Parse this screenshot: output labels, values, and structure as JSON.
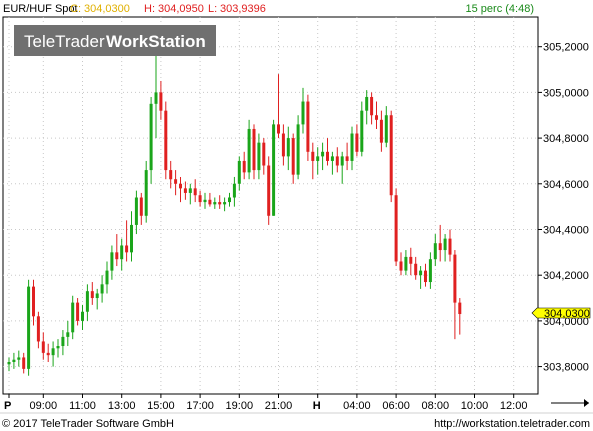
{
  "header": {
    "symbol": "EUR/HUF Spot",
    "close_label": "C:",
    "close_value": "304,0300",
    "high_label": "H:",
    "high_value": "304,0950",
    "low_label": "L:",
    "low_value": "303,9396",
    "interval": "15 perc (4:48)"
  },
  "watermark": {
    "brand": "TeleTrader",
    "product": "WorkStation"
  },
  "price_marker": "304,0300",
  "footer": {
    "copyright": "© 2017 TeleTrader Software GmbH",
    "url": "http://workstation.teletrader.com"
  },
  "colors": {
    "up": "#1aa51a",
    "down": "#e02020",
    "grid": "#c8c8c8",
    "marker_bg": "#ffff00",
    "close_label": "#e0b000",
    "high_low": "#e02020",
    "interval_text": "#1a8a1a",
    "watermark_bg": "#707070"
  },
  "chart_data": {
    "type": "candlestick",
    "title": "EUR/HUF Spot",
    "y_ticks": [
      "303,8000",
      "304,0000",
      "304,2000",
      "304,4000",
      "304,6000",
      "304,8000",
      "305,0000",
      "305,2000"
    ],
    "y_tick_values": [
      303.8,
      304.0,
      304.2,
      304.4,
      304.6,
      304.8,
      305.0,
      305.2
    ],
    "ylim": [
      303.68,
      305.33
    ],
    "x_ticks": [
      "P",
      "09:00",
      "11:00",
      "13:00",
      "15:00",
      "17:00",
      "19:00",
      "21:00",
      "H",
      "04:00",
      "06:00",
      "08:00",
      "10:00",
      "12:00"
    ],
    "x_tick_index": [
      0,
      7,
      15,
      23,
      31,
      39,
      47,
      55,
      63,
      71,
      79,
      87,
      95,
      103
    ],
    "candles": [
      [
        303.81,
        303.84,
        303.78,
        303.82
      ],
      [
        303.82,
        303.86,
        303.79,
        303.83
      ],
      [
        303.83,
        303.87,
        303.8,
        303.84
      ],
      [
        303.84,
        303.86,
        303.77,
        303.79
      ],
      [
        303.79,
        304.18,
        303.76,
        304.15
      ],
      [
        304.15,
        304.18,
        303.98,
        304.02
      ],
      [
        304.02,
        304.04,
        303.88,
        303.91
      ],
      [
        303.91,
        303.95,
        303.83,
        303.86
      ],
      [
        303.86,
        303.9,
        303.82,
        303.85
      ],
      [
        303.85,
        303.91,
        303.8,
        303.88
      ],
      [
        303.88,
        303.92,
        303.84,
        303.89
      ],
      [
        303.89,
        303.96,
        303.85,
        303.93
      ],
      [
        303.93,
        304.0,
        303.89,
        303.95
      ],
      [
        303.95,
        304.11,
        303.92,
        304.08
      ],
      [
        304.08,
        304.1,
        303.98,
        304.0
      ],
      [
        304.0,
        304.07,
        303.96,
        304.04
      ],
      [
        304.04,
        304.16,
        304.0,
        304.13
      ],
      [
        304.13,
        304.17,
        304.07,
        304.1
      ],
      [
        304.1,
        304.14,
        304.05,
        304.12
      ],
      [
        304.12,
        304.2,
        304.08,
        304.16
      ],
      [
        304.16,
        304.26,
        304.12,
        304.22
      ],
      [
        304.22,
        304.33,
        304.18,
        304.3
      ],
      [
        304.3,
        304.38,
        304.24,
        304.27
      ],
      [
        304.27,
        304.36,
        304.22,
        304.33
      ],
      [
        304.33,
        304.44,
        304.26,
        304.3
      ],
      [
        304.3,
        304.48,
        304.26,
        304.42
      ],
      [
        304.42,
        304.57,
        304.38,
        304.54
      ],
      [
        304.54,
        304.56,
        304.42,
        304.46
      ],
      [
        304.46,
        304.7,
        304.43,
        304.66
      ],
      [
        304.66,
        304.98,
        304.6,
        304.95
      ],
      [
        304.95,
        305.28,
        304.8,
        305.0
      ],
      [
        305.0,
        305.05,
        304.88,
        304.92
      ],
      [
        304.92,
        304.96,
        304.62,
        304.66
      ],
      [
        304.66,
        304.7,
        304.58,
        304.62
      ],
      [
        304.62,
        304.66,
        304.55,
        304.6
      ],
      [
        304.6,
        304.63,
        304.52,
        304.58
      ],
      [
        304.58,
        304.61,
        304.53,
        304.56
      ],
      [
        304.56,
        304.6,
        304.51,
        304.58
      ],
      [
        304.58,
        304.62,
        304.52,
        304.55
      ],
      [
        304.55,
        304.57,
        304.5,
        304.52
      ],
      [
        304.52,
        304.56,
        304.49,
        304.53
      ],
      [
        304.53,
        304.56,
        304.5,
        304.51
      ],
      [
        304.51,
        304.54,
        304.49,
        304.52
      ],
      [
        304.52,
        304.55,
        304.49,
        304.51
      ],
      [
        304.51,
        304.54,
        304.48,
        304.52
      ],
      [
        304.52,
        304.56,
        304.5,
        304.54
      ],
      [
        304.54,
        304.63,
        304.5,
        304.6
      ],
      [
        304.6,
        304.72,
        304.57,
        304.7
      ],
      [
        304.7,
        304.74,
        304.62,
        304.65
      ],
      [
        304.65,
        304.88,
        304.62,
        304.84
      ],
      [
        304.84,
        304.86,
        304.62,
        304.66
      ],
      [
        304.66,
        304.82,
        304.62,
        304.78
      ],
      [
        304.78,
        304.8,
        304.64,
        304.68
      ],
      [
        304.68,
        304.72,
        304.42,
        304.46
      ],
      [
        304.46,
        304.88,
        304.46,
        304.86
      ],
      [
        304.86,
        305.08,
        304.8,
        304.82
      ],
      [
        304.82,
        304.86,
        304.68,
        304.72
      ],
      [
        304.72,
        304.85,
        304.66,
        304.8
      ],
      [
        304.8,
        304.82,
        304.6,
        304.64
      ],
      [
        304.64,
        304.9,
        304.62,
        304.86
      ],
      [
        304.86,
        305.02,
        304.82,
        304.96
      ],
      [
        304.96,
        304.99,
        304.7,
        304.74
      ],
      [
        304.74,
        304.78,
        304.62,
        304.7
      ],
      [
        304.7,
        304.76,
        304.64,
        304.72
      ],
      [
        304.72,
        304.78,
        304.66,
        304.74
      ],
      [
        304.74,
        304.8,
        304.68,
        304.7
      ],
      [
        304.7,
        304.74,
        304.64,
        304.72
      ],
      [
        304.72,
        304.76,
        304.65,
        304.68
      ],
      [
        304.68,
        304.74,
        304.6,
        304.72
      ],
      [
        304.72,
        304.78,
        304.66,
        304.7
      ],
      [
        304.7,
        304.85,
        304.66,
        304.82
      ],
      [
        304.82,
        304.86,
        304.72,
        304.74
      ],
      [
        304.74,
        304.96,
        304.72,
        304.92
      ],
      [
        304.92,
        305.01,
        304.86,
        304.98
      ],
      [
        304.98,
        305.0,
        304.86,
        304.9
      ],
      [
        304.9,
        304.96,
        304.84,
        304.88
      ],
      [
        304.88,
        304.92,
        304.74,
        304.78
      ],
      [
        304.78,
        304.94,
        304.76,
        304.9
      ],
      [
        304.9,
        304.92,
        304.52,
        304.55
      ],
      [
        304.55,
        304.58,
        304.24,
        304.26
      ],
      [
        304.26,
        304.3,
        304.2,
        304.22
      ],
      [
        304.22,
        304.31,
        304.2,
        304.28
      ],
      [
        304.28,
        304.32,
        304.2,
        304.25
      ],
      [
        304.25,
        304.28,
        304.18,
        304.2
      ],
      [
        304.2,
        304.24,
        304.14,
        304.22
      ],
      [
        304.22,
        304.25,
        304.15,
        304.17
      ],
      [
        304.17,
        304.3,
        304.14,
        304.27
      ],
      [
        304.27,
        304.38,
        304.24,
        304.34
      ],
      [
        304.34,
        304.42,
        304.26,
        304.31
      ],
      [
        304.31,
        304.38,
        304.26,
        304.36
      ],
      [
        304.36,
        304.4,
        304.26,
        304.29
      ],
      [
        304.29,
        304.31,
        303.92,
        304.08
      ],
      [
        304.08,
        304.1,
        303.94,
        304.03
      ]
    ]
  }
}
